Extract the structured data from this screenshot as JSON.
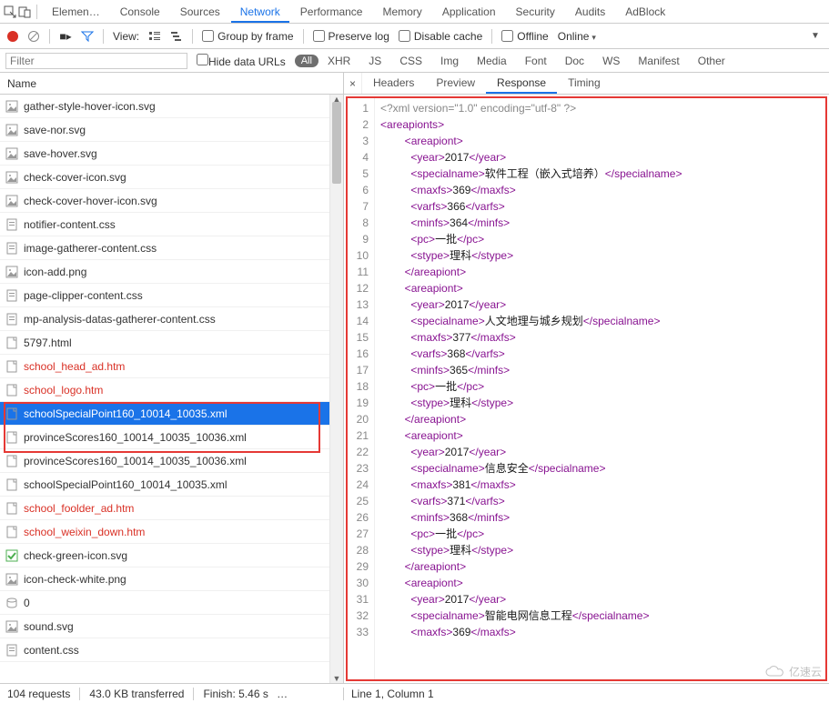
{
  "tabs": {
    "items": [
      "Elemen…",
      "Console",
      "Sources",
      "Network",
      "Performance",
      "Memory",
      "Application",
      "Security",
      "Audits",
      "AdBlock"
    ],
    "active_index": 3
  },
  "toolbar": {
    "view_label": "View:",
    "group_by_frame": "Group by frame",
    "preserve_log": "Preserve log",
    "disable_cache": "Disable cache",
    "offline": "Offline",
    "throttling": "Online"
  },
  "filterbar": {
    "placeholder": "Filter",
    "hide_data_urls": "Hide data URLs",
    "all_pill": "All",
    "types": [
      "XHR",
      "JS",
      "CSS",
      "Img",
      "Media",
      "Font",
      "Doc",
      "WS",
      "Manifest",
      "Other"
    ]
  },
  "left": {
    "header": "Name",
    "rows": [
      {
        "name": "gather-style-hover-icon.svg",
        "icon": "img",
        "red": false
      },
      {
        "name": "save-nor.svg",
        "icon": "img",
        "red": false
      },
      {
        "name": "save-hover.svg",
        "icon": "img",
        "red": false
      },
      {
        "name": "check-cover-icon.svg",
        "icon": "img",
        "red": false
      },
      {
        "name": "check-cover-hover-icon.svg",
        "icon": "img",
        "red": false
      },
      {
        "name": "notifier-content.css",
        "icon": "css",
        "red": false
      },
      {
        "name": "image-gatherer-content.css",
        "icon": "css",
        "red": false
      },
      {
        "name": "icon-add.png",
        "icon": "img",
        "red": false
      },
      {
        "name": "page-clipper-content.css",
        "icon": "css",
        "red": false
      },
      {
        "name": "mp-analysis-datas-gatherer-content.css",
        "icon": "css",
        "red": false
      },
      {
        "name": "5797.html",
        "icon": "doc",
        "red": false
      },
      {
        "name": "school_head_ad.htm",
        "icon": "doc",
        "red": true
      },
      {
        "name": "school_logo.htm",
        "icon": "doc",
        "red": true
      },
      {
        "name": "schoolSpecialPoint160_10014_10035.xml",
        "icon": "doc",
        "red": false,
        "selected": true
      },
      {
        "name": "provinceScores160_10014_10035_10036.xml",
        "icon": "doc",
        "red": false
      },
      {
        "name": "provinceScores160_10014_10035_10036.xml",
        "icon": "doc",
        "red": false
      },
      {
        "name": "schoolSpecialPoint160_10014_10035.xml",
        "icon": "doc",
        "red": false
      },
      {
        "name": "school_foolder_ad.htm",
        "icon": "doc",
        "red": true
      },
      {
        "name": "school_weixin_down.htm",
        "icon": "doc",
        "red": true
      },
      {
        "name": "check-green-icon.svg",
        "icon": "img",
        "red": false,
        "check": true
      },
      {
        "name": "icon-check-white.png",
        "icon": "img",
        "red": false
      },
      {
        "name": "0",
        "icon": "data",
        "red": false
      },
      {
        "name": "sound.svg",
        "icon": "img",
        "red": false
      },
      {
        "name": "content.css",
        "icon": "css",
        "red": false
      }
    ]
  },
  "right": {
    "tabs": [
      "Headers",
      "Preview",
      "Response",
      "Timing"
    ],
    "active_index": 2,
    "cursor": "Line 1, Column 1",
    "code_lines": [
      {
        "n": 1,
        "html": "<span class='c-decl'>&lt;?xml version=\"1.0\" encoding=\"utf-8\" ?&gt;</span>"
      },
      {
        "n": 2,
        "html": "<span class='c-punc'>&lt;</span><span class='c-tag'>areapionts</span><span class='c-punc'>&gt;</span>"
      },
      {
        "n": 3,
        "html": "        <span class='c-punc'>&lt;</span><span class='c-tag'>areapiont</span><span class='c-punc'>&gt;</span>"
      },
      {
        "n": 4,
        "html": "          <span class='c-punc'>&lt;</span><span class='c-tag'>year</span><span class='c-punc'>&gt;</span><span class='c-text'>2017</span><span class='c-punc'>&lt;/</span><span class='c-tag'>year</span><span class='c-punc'>&gt;</span>"
      },
      {
        "n": 5,
        "html": "          <span class='c-punc'>&lt;</span><span class='c-tag'>specialname</span><span class='c-punc'>&gt;</span><span class='c-cjk'>软件工程（嵌入式培养）</span><span class='c-punc'>&lt;/</span><span class='c-tag'>specialname</span><span class='c-punc'>&gt;</span>"
      },
      {
        "n": 6,
        "html": "          <span class='c-punc'>&lt;</span><span class='c-tag'>maxfs</span><span class='c-punc'>&gt;</span><span class='c-text'>369</span><span class='c-punc'>&lt;/</span><span class='c-tag'>maxfs</span><span class='c-punc'>&gt;</span>"
      },
      {
        "n": 7,
        "html": "          <span class='c-punc'>&lt;</span><span class='c-tag'>varfs</span><span class='c-punc'>&gt;</span><span class='c-text'>366</span><span class='c-punc'>&lt;/</span><span class='c-tag'>varfs</span><span class='c-punc'>&gt;</span>"
      },
      {
        "n": 8,
        "html": "          <span class='c-punc'>&lt;</span><span class='c-tag'>minfs</span><span class='c-punc'>&gt;</span><span class='c-text'>364</span><span class='c-punc'>&lt;/</span><span class='c-tag'>minfs</span><span class='c-punc'>&gt;</span>"
      },
      {
        "n": 9,
        "html": "          <span class='c-punc'>&lt;</span><span class='c-tag'>pc</span><span class='c-punc'>&gt;</span><span class='c-cjk'>一批</span><span class='c-punc'>&lt;/</span><span class='c-tag'>pc</span><span class='c-punc'>&gt;</span>"
      },
      {
        "n": 10,
        "html": "          <span class='c-punc'>&lt;</span><span class='c-tag'>stype</span><span class='c-punc'>&gt;</span><span class='c-cjk'>理科</span><span class='c-punc'>&lt;/</span><span class='c-tag'>stype</span><span class='c-punc'>&gt;</span>"
      },
      {
        "n": 11,
        "html": "        <span class='c-punc'>&lt;/</span><span class='c-tag'>areapiont</span><span class='c-punc'>&gt;</span>"
      },
      {
        "n": 12,
        "html": "        <span class='c-punc'>&lt;</span><span class='c-tag'>areapiont</span><span class='c-punc'>&gt;</span>"
      },
      {
        "n": 13,
        "html": "          <span class='c-punc'>&lt;</span><span class='c-tag'>year</span><span class='c-punc'>&gt;</span><span class='c-text'>2017</span><span class='c-punc'>&lt;/</span><span class='c-tag'>year</span><span class='c-punc'>&gt;</span>"
      },
      {
        "n": 14,
        "html": "          <span class='c-punc'>&lt;</span><span class='c-tag'>specialname</span><span class='c-punc'>&gt;</span><span class='c-cjk'>人文地理与城乡规划</span><span class='c-punc'>&lt;/</span><span class='c-tag'>specialname</span><span class='c-punc'>&gt;</span>"
      },
      {
        "n": 15,
        "html": "          <span class='c-punc'>&lt;</span><span class='c-tag'>maxfs</span><span class='c-punc'>&gt;</span><span class='c-text'>377</span><span class='c-punc'>&lt;/</span><span class='c-tag'>maxfs</span><span class='c-punc'>&gt;</span>"
      },
      {
        "n": 16,
        "html": "          <span class='c-punc'>&lt;</span><span class='c-tag'>varfs</span><span class='c-punc'>&gt;</span><span class='c-text'>368</span><span class='c-punc'>&lt;/</span><span class='c-tag'>varfs</span><span class='c-punc'>&gt;</span>"
      },
      {
        "n": 17,
        "html": "          <span class='c-punc'>&lt;</span><span class='c-tag'>minfs</span><span class='c-punc'>&gt;</span><span class='c-text'>365</span><span class='c-punc'>&lt;/</span><span class='c-tag'>minfs</span><span class='c-punc'>&gt;</span>"
      },
      {
        "n": 18,
        "html": "          <span class='c-punc'>&lt;</span><span class='c-tag'>pc</span><span class='c-punc'>&gt;</span><span class='c-cjk'>一批</span><span class='c-punc'>&lt;/</span><span class='c-tag'>pc</span><span class='c-punc'>&gt;</span>"
      },
      {
        "n": 19,
        "html": "          <span class='c-punc'>&lt;</span><span class='c-tag'>stype</span><span class='c-punc'>&gt;</span><span class='c-cjk'>理科</span><span class='c-punc'>&lt;/</span><span class='c-tag'>stype</span><span class='c-punc'>&gt;</span>"
      },
      {
        "n": 20,
        "html": "        <span class='c-punc'>&lt;/</span><span class='c-tag'>areapiont</span><span class='c-punc'>&gt;</span>"
      },
      {
        "n": 21,
        "html": "        <span class='c-punc'>&lt;</span><span class='c-tag'>areapiont</span><span class='c-punc'>&gt;</span>"
      },
      {
        "n": 22,
        "html": "          <span class='c-punc'>&lt;</span><span class='c-tag'>year</span><span class='c-punc'>&gt;</span><span class='c-text'>2017</span><span class='c-punc'>&lt;/</span><span class='c-tag'>year</span><span class='c-punc'>&gt;</span>"
      },
      {
        "n": 23,
        "html": "          <span class='c-punc'>&lt;</span><span class='c-tag'>specialname</span><span class='c-punc'>&gt;</span><span class='c-cjk'>信息安全</span><span class='c-punc'>&lt;/</span><span class='c-tag'>specialname</span><span class='c-punc'>&gt;</span>"
      },
      {
        "n": 24,
        "html": "          <span class='c-punc'>&lt;</span><span class='c-tag'>maxfs</span><span class='c-punc'>&gt;</span><span class='c-text'>381</span><span class='c-punc'>&lt;/</span><span class='c-tag'>maxfs</span><span class='c-punc'>&gt;</span>"
      },
      {
        "n": 25,
        "html": "          <span class='c-punc'>&lt;</span><span class='c-tag'>varfs</span><span class='c-punc'>&gt;</span><span class='c-text'>371</span><span class='c-punc'>&lt;/</span><span class='c-tag'>varfs</span><span class='c-punc'>&gt;</span>"
      },
      {
        "n": 26,
        "html": "          <span class='c-punc'>&lt;</span><span class='c-tag'>minfs</span><span class='c-punc'>&gt;</span><span class='c-text'>368</span><span class='c-punc'>&lt;/</span><span class='c-tag'>minfs</span><span class='c-punc'>&gt;</span>"
      },
      {
        "n": 27,
        "html": "          <span class='c-punc'>&lt;</span><span class='c-tag'>pc</span><span class='c-punc'>&gt;</span><span class='c-cjk'>一批</span><span class='c-punc'>&lt;/</span><span class='c-tag'>pc</span><span class='c-punc'>&gt;</span>"
      },
      {
        "n": 28,
        "html": "          <span class='c-punc'>&lt;</span><span class='c-tag'>stype</span><span class='c-punc'>&gt;</span><span class='c-cjk'>理科</span><span class='c-punc'>&lt;/</span><span class='c-tag'>stype</span><span class='c-punc'>&gt;</span>"
      },
      {
        "n": 29,
        "html": "        <span class='c-punc'>&lt;/</span><span class='c-tag'>areapiont</span><span class='c-punc'>&gt;</span>"
      },
      {
        "n": 30,
        "html": "        <span class='c-punc'>&lt;</span><span class='c-tag'>areapiont</span><span class='c-punc'>&gt;</span>"
      },
      {
        "n": 31,
        "html": "          <span class='c-punc'>&lt;</span><span class='c-tag'>year</span><span class='c-punc'>&gt;</span><span class='c-text'>2017</span><span class='c-punc'>&lt;/</span><span class='c-tag'>year</span><span class='c-punc'>&gt;</span>"
      },
      {
        "n": 32,
        "html": "          <span class='c-punc'>&lt;</span><span class='c-tag'>specialname</span><span class='c-punc'>&gt;</span><span class='c-cjk'>智能电网信息工程</span><span class='c-punc'>&lt;/</span><span class='c-tag'>specialname</span><span class='c-punc'>&gt;</span>"
      },
      {
        "n": 33,
        "html": "          <span class='c-punc'>&lt;</span><span class='c-tag'>maxfs</span><span class='c-punc'>&gt;</span><span class='c-text'>369</span><span class='c-punc'>&lt;/</span><span class='c-tag'>maxfs</span><span class='c-punc'>&gt;</span>"
      }
    ]
  },
  "status": {
    "requests": "104 requests",
    "transferred": "43.0 KB transferred",
    "finish": "Finish: 5.46 s"
  },
  "watermark": "亿速云"
}
